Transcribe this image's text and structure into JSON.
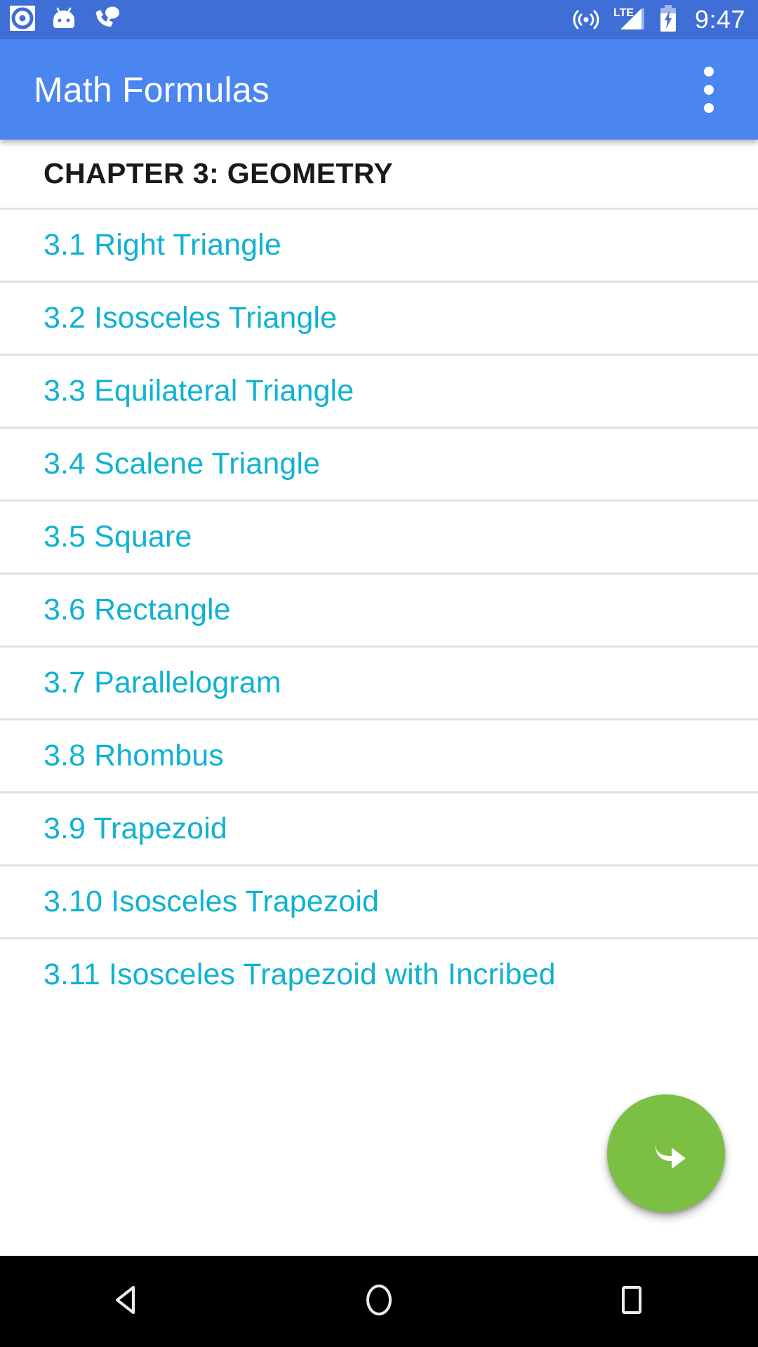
{
  "status_bar": {
    "background_color": "#3F6ED6",
    "clock": "9:47",
    "left_icons": [
      {
        "name": "screen-recorder-icon",
        "label": "screen-recorder"
      },
      {
        "name": "android-head-icon",
        "label": "android-system"
      },
      {
        "name": "missed-call-icon",
        "label": "phone-message"
      }
    ],
    "right_icons": [
      {
        "name": "hotspot-icon",
        "label": "hotspot"
      },
      {
        "name": "lte-signal-icon",
        "label": "LTE"
      },
      {
        "name": "battery-charging-icon",
        "label": "battery-charging"
      }
    ],
    "lte_label": "LTE"
  },
  "app_bar": {
    "title": "Math Formulas",
    "background_color": "#4A85F0",
    "overflow_menu": "more-options"
  },
  "main": {
    "section_header": "CHAPTER 3: GEOMETRY",
    "link_color": "#0FB2D0",
    "items": [
      {
        "label": "3.1 Right Triangle"
      },
      {
        "label": "3.2 Isosceles Triangle"
      },
      {
        "label": "3.3 Equilateral Triangle"
      },
      {
        "label": "3.4 Scalene Triangle"
      },
      {
        "label": "3.5 Square"
      },
      {
        "label": "3.6 Rectangle"
      },
      {
        "label": "3.7 Parallelogram"
      },
      {
        "label": "3.8 Rhombus"
      },
      {
        "label": "3.9 Trapezoid"
      },
      {
        "label": "3.10 Isosceles Trapezoid"
      },
      {
        "label": "3.11 Isosceles Trapezoid with Incribed"
      }
    ]
  },
  "fab": {
    "name": "next-chapter-button",
    "icon": "curved-arrow-right-icon",
    "color": "#7CC043"
  },
  "nav_bar": {
    "background_color": "#000000",
    "buttons": [
      {
        "name": "back-button",
        "icon": "triangle-left-icon"
      },
      {
        "name": "home-button",
        "icon": "circle-icon"
      },
      {
        "name": "recents-button",
        "icon": "square-icon"
      }
    ]
  }
}
